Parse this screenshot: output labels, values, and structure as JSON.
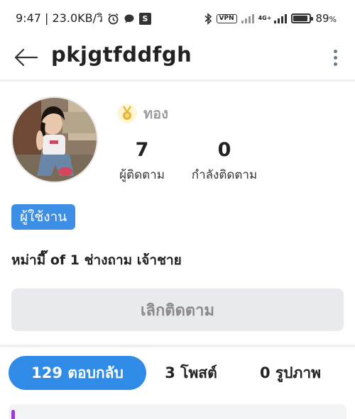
{
  "status_bar": {
    "time_and_speed": "9:47 | 23.0KB/วิ",
    "vpn_label": "VPN",
    "network_label": "4G+",
    "battery_percent": "89",
    "battery_suffix": "%",
    "battery_level": 0.89
  },
  "header": {
    "title": "pkjgtfddfgh"
  },
  "profile": {
    "badge_label": "ทอง",
    "followers_count": "7",
    "followers_label": "ผู้ติดตาม",
    "following_count": "0",
    "following_label": "กำลังติดตาม",
    "role_tag": "ผู้ใช้งาน",
    "bio": "หม่ามี๊ of 1 ช่างถาม เจ้าชาย",
    "unfollow_label": "เลิกติดตาม"
  },
  "tabs": [
    {
      "label": "129 ตอบกลับ",
      "active": true
    },
    {
      "label": "3 โพสต์",
      "active": false
    },
    {
      "label": "0 รูปภาพ",
      "active": false
    }
  ],
  "colors": {
    "accent": "#2f8be6",
    "role_tag": "#3d8fe6",
    "button_bg": "#e8eaee",
    "medal_gold": "#e6b43a"
  },
  "icons": {
    "back": "arrow-left-icon",
    "more": "more-vertical-icon",
    "medal": "medal-icon",
    "bluetooth": "bluetooth-icon",
    "alarm": "alarm-icon",
    "chat": "chat-icon"
  }
}
